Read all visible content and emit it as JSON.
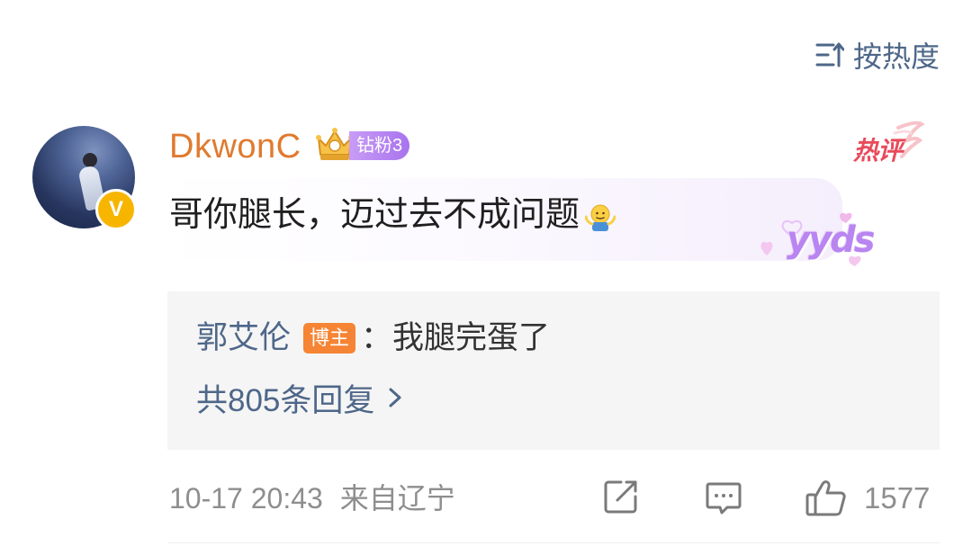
{
  "sort": {
    "label": "按热度",
    "icon": "sort-icon"
  },
  "comment": {
    "username": "DkwonC",
    "avatar_badge": "V",
    "fan_badge": "钻粉3",
    "hot_tag": "热评",
    "text": "哥你腿长，迈过去不成问题",
    "emoji_icon": "shrug-emoji-icon",
    "sticker_text": "yyds",
    "time": "10-17 20:43",
    "location": "来自辽宁",
    "like_count": "1577"
  },
  "reply": {
    "author": "郭艾伦",
    "author_badge": "博主",
    "separator": "：",
    "text": "我腿完蛋了",
    "count_label": "共805条回复"
  },
  "colors": {
    "username": "#e07a2f",
    "link_blue": "#4e6789",
    "host_badge": "#f58534",
    "fan_badge": "#a873ee",
    "hot_red": "#e94b5b",
    "meta_gray": "#8e8e8e",
    "reply_bg": "#f5f5f5"
  }
}
